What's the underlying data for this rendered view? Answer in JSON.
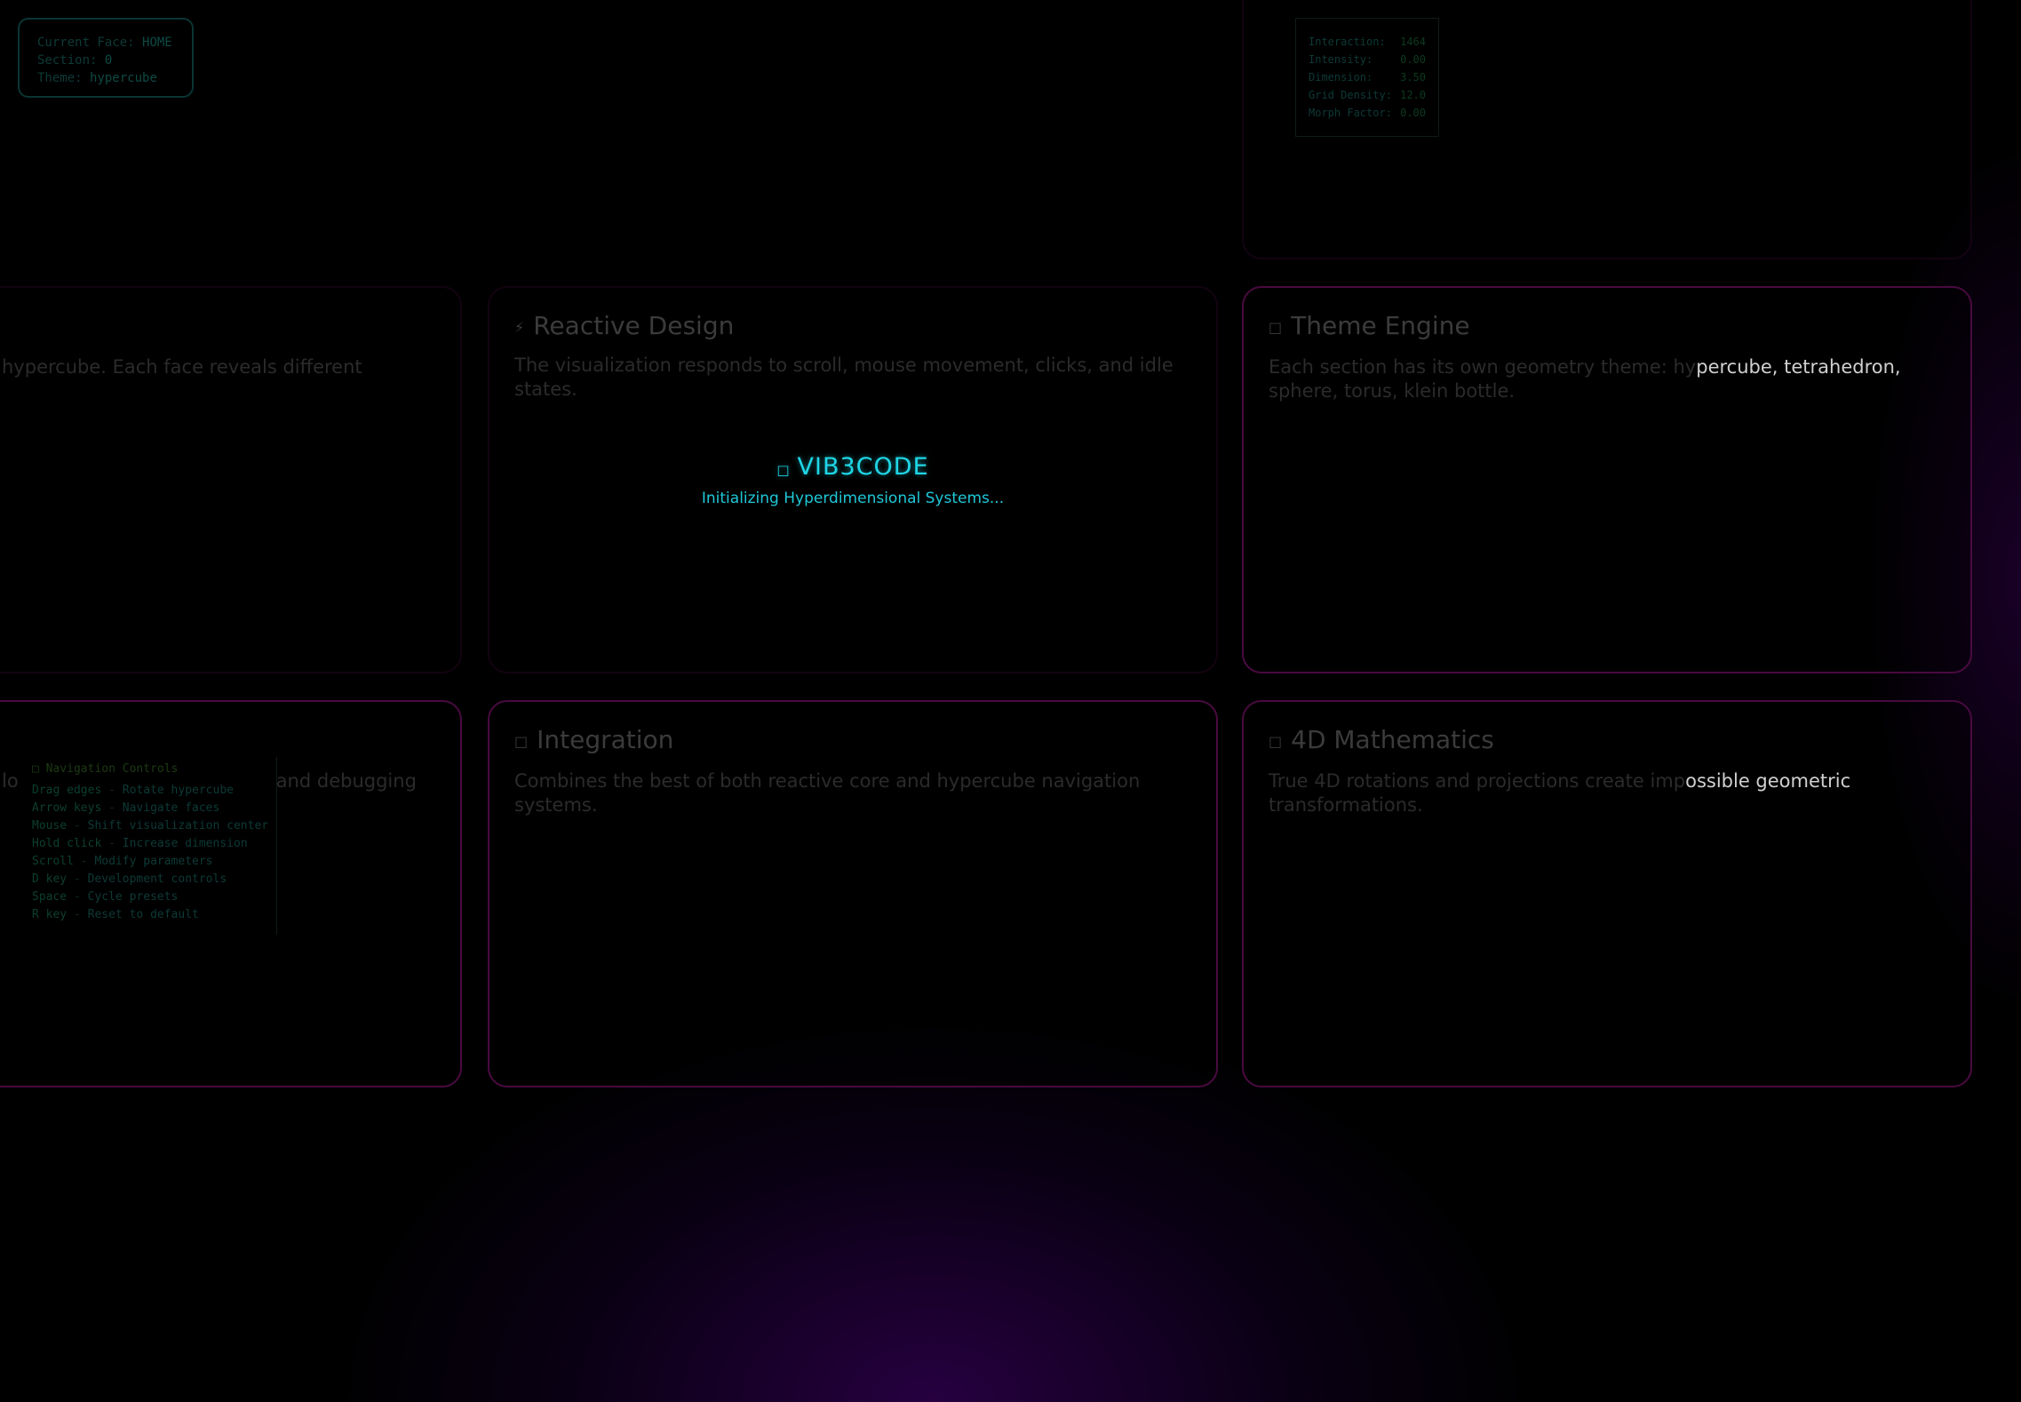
{
  "status": {
    "current_face_label": "Current Face:",
    "current_face_value": "HOME",
    "section_label": "Section:",
    "section_value": "0",
    "theme_label": "Theme:",
    "theme_value": "hypercube"
  },
  "params": [
    {
      "label": "Interaction:",
      "value": "1464"
    },
    {
      "label": "Intensity:",
      "value": "0.00"
    },
    {
      "label": "Dimension:",
      "value": "3.50"
    },
    {
      "label": "Grid Density:",
      "value": "12.0"
    },
    {
      "label": "Morph Factor:",
      "value": "0.00"
    }
  ],
  "controls": {
    "heading": "□ Navigation Controls",
    "items": [
      {
        "key": "Drag edges",
        "action": "Rotate hypercube"
      },
      {
        "key": "Arrow keys",
        "action": "Navigate faces"
      },
      {
        "key": "Mouse",
        "action": "Shift visualization center"
      },
      {
        "key": "Hold click",
        "action": "Increase dimension"
      },
      {
        "key": "Scroll",
        "action": "Modify parameters"
      },
      {
        "key": "D key",
        "action": "Development controls"
      },
      {
        "key": "Space",
        "action": "Cycle presets"
      },
      {
        "key": "R key",
        "action": "Reset to default"
      }
    ],
    "separator": " - "
  },
  "cards": {
    "left_top_desc": "hypercube. Each face reveals different",
    "left_bottom_desc_a": "lo",
    "left_bottom_desc_b": "and debugging",
    "reactive": {
      "glyph": "⚡",
      "title": "Reactive Design",
      "desc": "The visualization responds to scroll, mouse movement, clicks, and idle states."
    },
    "theme": {
      "glyph": "□",
      "title": "Theme Engine",
      "desc_dim": "Each section has its own geometry theme: hy",
      "desc_bright": "percube, tetrahedron,",
      "desc_line2": "sphere, torus, klein bottle."
    },
    "integration": {
      "glyph": "□",
      "title": "Integration",
      "desc": "Combines the best of both reactive core and hypercube navigation systems."
    },
    "math": {
      "glyph": "□",
      "title": "4D Mathematics",
      "desc_dim": "True 4D rotations and projections create imp",
      "desc_bright": "ossible geometric",
      "desc_line2": "transformations."
    }
  },
  "loader": {
    "glyph": "□",
    "title": "VIB3CODE",
    "subtitle": "Initializing Hyperdimensional Systems..."
  },
  "colors": {
    "background": "#000000",
    "card_border": "#4a0a40",
    "accent": "#1fd6e6",
    "glow": "#2d004b"
  }
}
